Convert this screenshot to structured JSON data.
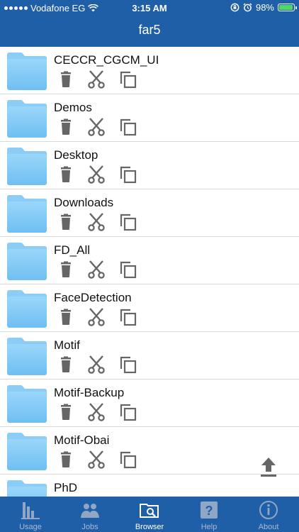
{
  "status_bar": {
    "carrier": "Vodafone EG",
    "time": "3:15 AM",
    "battery": "98%"
  },
  "nav": {
    "title": "far5"
  },
  "folders": [
    {
      "name": "CECCR_CGCM_UI"
    },
    {
      "name": "Demos"
    },
    {
      "name": "Desktop"
    },
    {
      "name": "Downloads"
    },
    {
      "name": "FD_All"
    },
    {
      "name": "FaceDetection"
    },
    {
      "name": "Motif"
    },
    {
      "name": "Motif-Backup"
    },
    {
      "name": "Motif-Obai"
    },
    {
      "name": "PhD"
    }
  ],
  "tabs": [
    {
      "label": "Usage",
      "icon": "bar-chart-icon"
    },
    {
      "label": "Jobs",
      "icon": "users-icon"
    },
    {
      "label": "Browser",
      "icon": "folder-search-icon"
    },
    {
      "label": "Help",
      "icon": "question-icon"
    },
    {
      "label": "About",
      "icon": "info-icon"
    }
  ],
  "active_tab": "Browser",
  "colors": {
    "bar": "#1f5fa8",
    "folder": "#7cc8f5",
    "icon_gray": "#666666",
    "inactive_tab": "#a9b9cf"
  }
}
